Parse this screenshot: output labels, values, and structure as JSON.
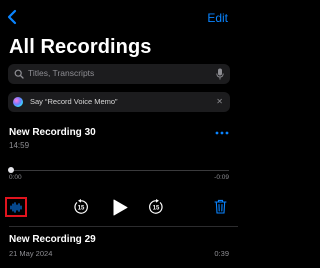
{
  "nav": {
    "back_icon": "chevron-left-icon",
    "edit_label": "Edit",
    "accent": "#0a84ff"
  },
  "page": {
    "title": "All Recordings"
  },
  "search": {
    "placeholder": "Titles, Transcripts",
    "icon": "search-icon",
    "mic_icon": "microphone-icon"
  },
  "siri_tip": {
    "text": "Say “Record Voice Memo”",
    "close_icon": "close-icon"
  },
  "recordings": [
    {
      "title": "New Recording 30",
      "duration": "14:59",
      "elapsed": "0:00",
      "remaining": "-0:09",
      "progress": 0.0,
      "expanded": true
    },
    {
      "title": "New Recording 29",
      "date": "21 May 2024",
      "duration": "0:39",
      "expanded": false
    }
  ],
  "player_controls": {
    "waveform_icon": "waveform-icon",
    "skip_back": {
      "icon": "skip-back-15-icon",
      "seconds": "15"
    },
    "play_icon": "play-icon",
    "skip_forward": {
      "icon": "skip-forward-15-icon",
      "seconds": "15"
    },
    "delete_icon": "trash-icon",
    "highlight_color": "#e0141e"
  }
}
